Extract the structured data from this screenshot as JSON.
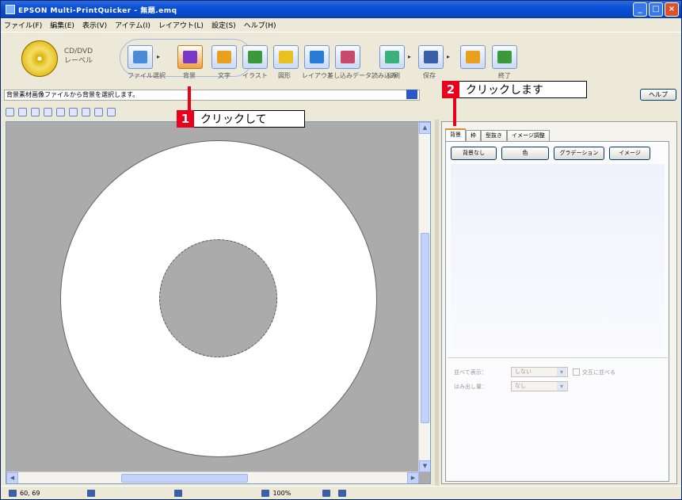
{
  "window": {
    "title": "EPSON Multi-PrintQuicker - 無題.emq",
    "controls": [
      "_",
      "□",
      "×"
    ]
  },
  "menu": [
    "ファイル(F)",
    "編集(E)",
    "表示(V)",
    "アイテム(I)",
    "レイアウト(L)",
    "設定(S)",
    "ヘルプ(H)"
  ],
  "toolbar": {
    "product_label_line1": "CD/DVD",
    "product_label_line2": "レーベル",
    "buttons": [
      {
        "label": "ファイル選択",
        "icon": "file-select-icon"
      },
      {
        "label": "背景",
        "icon": "background-icon"
      },
      {
        "label": "文字",
        "icon": "text-icon"
      },
      {
        "label": "イラスト",
        "icon": "illustration-icon"
      },
      {
        "label": "図形",
        "icon": "shape-icon"
      },
      {
        "label": "レイアウト",
        "icon": "layout-icon"
      },
      {
        "label": "差し込みデータ読み込み",
        "icon": "merge-data-icon"
      },
      {
        "label": "印刷",
        "icon": "print-icon"
      },
      {
        "label": "保存",
        "icon": "save-icon"
      },
      {
        "label": "終了",
        "icon": "exit-icon"
      }
    ]
  },
  "status_line": {
    "text": "背景素材画像ファイルから背景を選択します。",
    "help_label": "ヘルプ"
  },
  "panel": {
    "tabs": [
      "背景",
      "枠",
      "型抜き",
      "イメージ調整"
    ],
    "selected_tab": "背景",
    "background_buttons": [
      "背景なし",
      "色",
      "グラデーション",
      "イメージ"
    ],
    "options": [
      {
        "label": "並べて表示：",
        "value": "しない"
      },
      {
        "label": "はみ出し量：",
        "value": "なし"
      }
    ],
    "checkbox_label": "交互に並べる"
  },
  "statusbar": {
    "coords": "60, 69",
    "zoom": "100%"
  },
  "annotations": [
    {
      "number": "1",
      "text": "クリックして"
    },
    {
      "number": "2",
      "text": "クリックします"
    }
  ],
  "colors": {
    "title_bar": "#0a4fd4",
    "callout_red": "#e8001c",
    "canvas_gray": "#ababab"
  }
}
